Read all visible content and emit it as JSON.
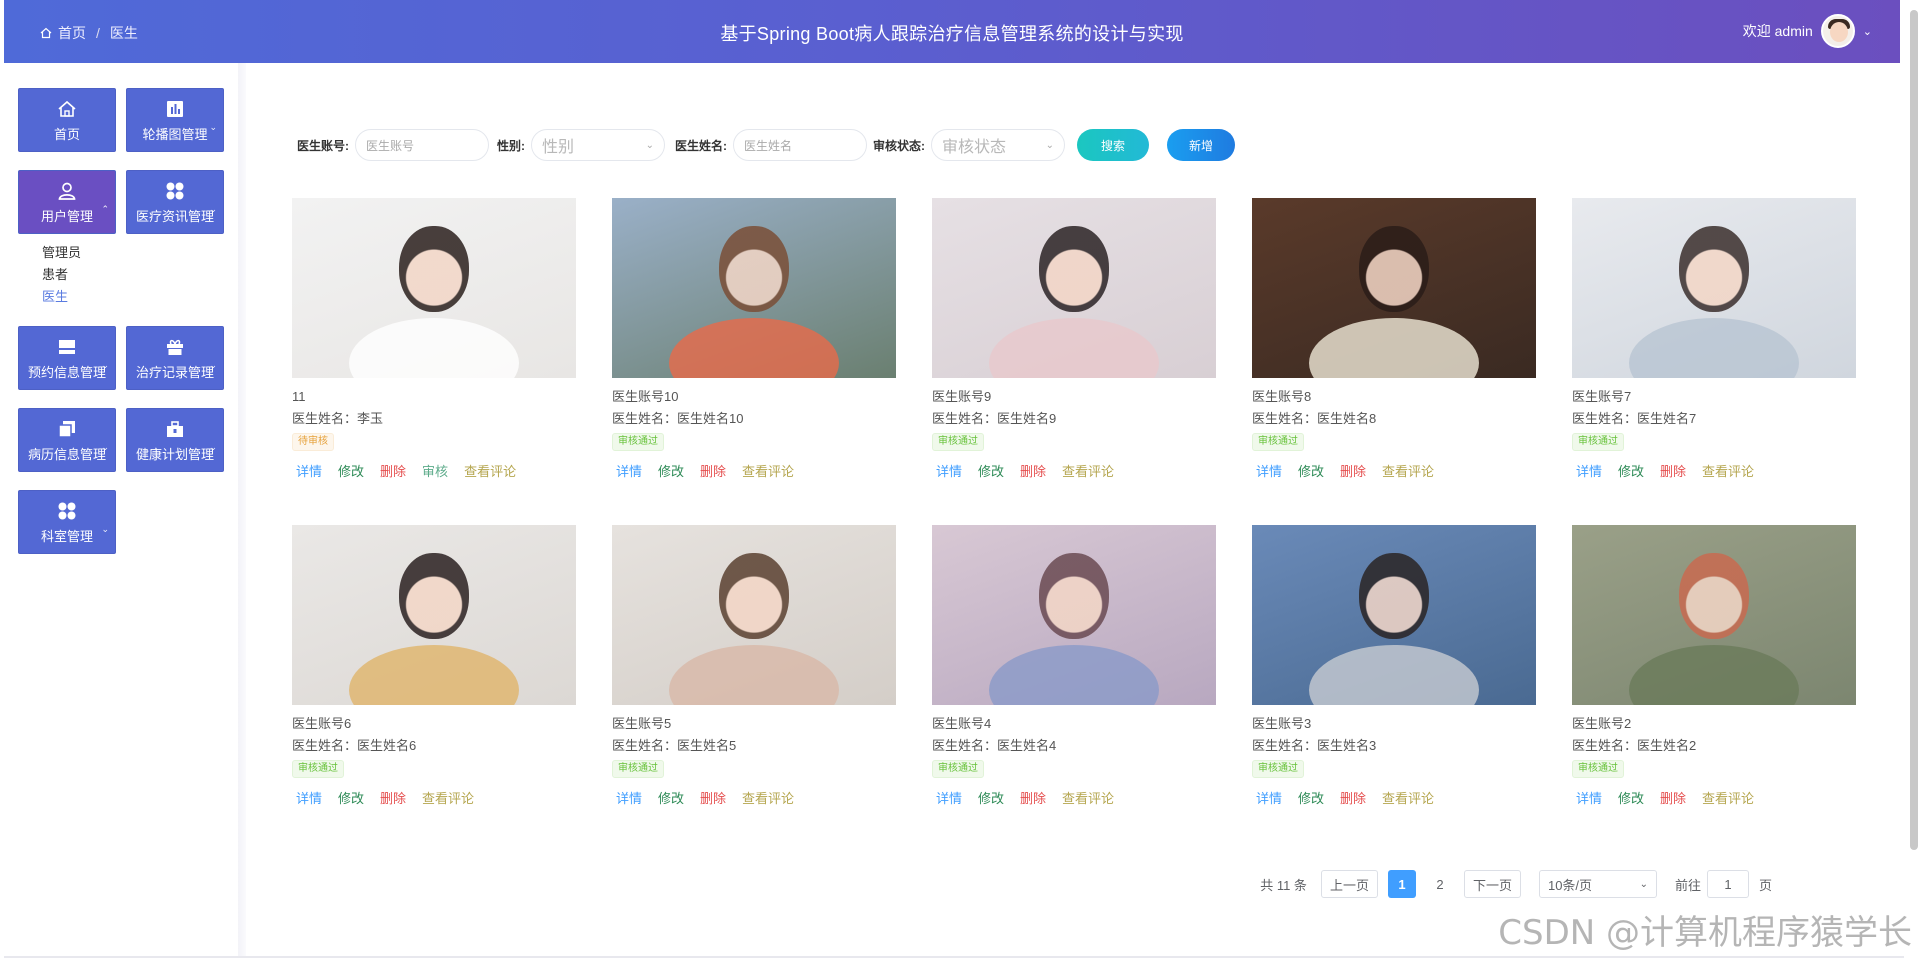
{
  "header": {
    "breadcrumb": [
      "首页",
      "医生"
    ],
    "title": "基于Spring Boot病人跟踪治疗信息管理系统的设计与实现",
    "welcome": "欢迎 admin"
  },
  "sidebar": {
    "tiles": [
      {
        "label": "首页",
        "icon": "home-icon"
      },
      {
        "label": "轮播图管理",
        "icon": "chart-icon"
      },
      {
        "label": "用户管理",
        "icon": "user-icon"
      },
      {
        "label": "医疗资讯管理",
        "icon": "grid-icon"
      },
      {
        "label": "预约信息管理",
        "icon": "layout-icon"
      },
      {
        "label": "治疗记录管理",
        "icon": "gift-icon"
      },
      {
        "label": "病历信息管理",
        "icon": "copy-icon"
      },
      {
        "label": "健康计划管理",
        "icon": "toolbox-icon"
      },
      {
        "label": "科室管理",
        "icon": "grid-icon"
      }
    ],
    "submenu": [
      "管理员",
      "患者",
      "医生"
    ]
  },
  "search": {
    "account_label": "医生账号:",
    "account_placeholder": "医生账号",
    "gender_label": "性别:",
    "gender_placeholder": "性别",
    "name_label": "医生姓名:",
    "name_placeholder": "医生姓名",
    "status_label": "审核状态:",
    "status_placeholder": "审核状态",
    "search_btn": "搜索",
    "add_btn": "新增"
  },
  "cards": [
    {
      "account": "11",
      "name": "医生姓名：李玉",
      "status": "待审核",
      "actions": [
        "详情",
        "修改",
        "删除",
        "审核",
        "查看评论"
      ]
    },
    {
      "account": "医生账号10",
      "name": "医生姓名：医生姓名10",
      "status": "审核通过",
      "actions": [
        "详情",
        "修改",
        "删除",
        "查看评论"
      ]
    },
    {
      "account": "医生账号9",
      "name": "医生姓名：医生姓名9",
      "status": "审核通过",
      "actions": [
        "详情",
        "修改",
        "删除",
        "查看评论"
      ]
    },
    {
      "account": "医生账号8",
      "name": "医生姓名：医生姓名8",
      "status": "审核通过",
      "actions": [
        "详情",
        "修改",
        "删除",
        "查看评论"
      ]
    },
    {
      "account": "医生账号7",
      "name": "医生姓名：医生姓名7",
      "status": "审核通过",
      "actions": [
        "详情",
        "修改",
        "删除",
        "查看评论"
      ]
    },
    {
      "account": "医生账号6",
      "name": "医生姓名：医生姓名6",
      "status": "审核通过",
      "actions": [
        "详情",
        "修改",
        "删除",
        "查看评论"
      ]
    },
    {
      "account": "医生账号5",
      "name": "医生姓名：医生姓名5",
      "status": "审核通过",
      "actions": [
        "详情",
        "修改",
        "删除",
        "查看评论"
      ]
    },
    {
      "account": "医生账号4",
      "name": "医生姓名：医生姓名4",
      "status": "审核通过",
      "actions": [
        "详情",
        "修改",
        "删除",
        "查看评论"
      ]
    },
    {
      "account": "医生账号3",
      "name": "医生姓名：医生姓名3",
      "status": "审核通过",
      "actions": [
        "详情",
        "修改",
        "删除",
        "查看评论"
      ]
    },
    {
      "account": "医生账号2",
      "name": "医生姓名：医生姓名2",
      "status": "审核通过",
      "actions": [
        "详情",
        "修改",
        "删除",
        "查看评论"
      ]
    }
  ],
  "pagination": {
    "total": "共 11 条",
    "prev": "上一页",
    "pages": [
      "1",
      "2"
    ],
    "next": "下一页",
    "size": "10条/页",
    "goto": "前往",
    "goto_value": "1",
    "page_unit": "页"
  },
  "watermark": "CSDN @计算机程序猿学长"
}
